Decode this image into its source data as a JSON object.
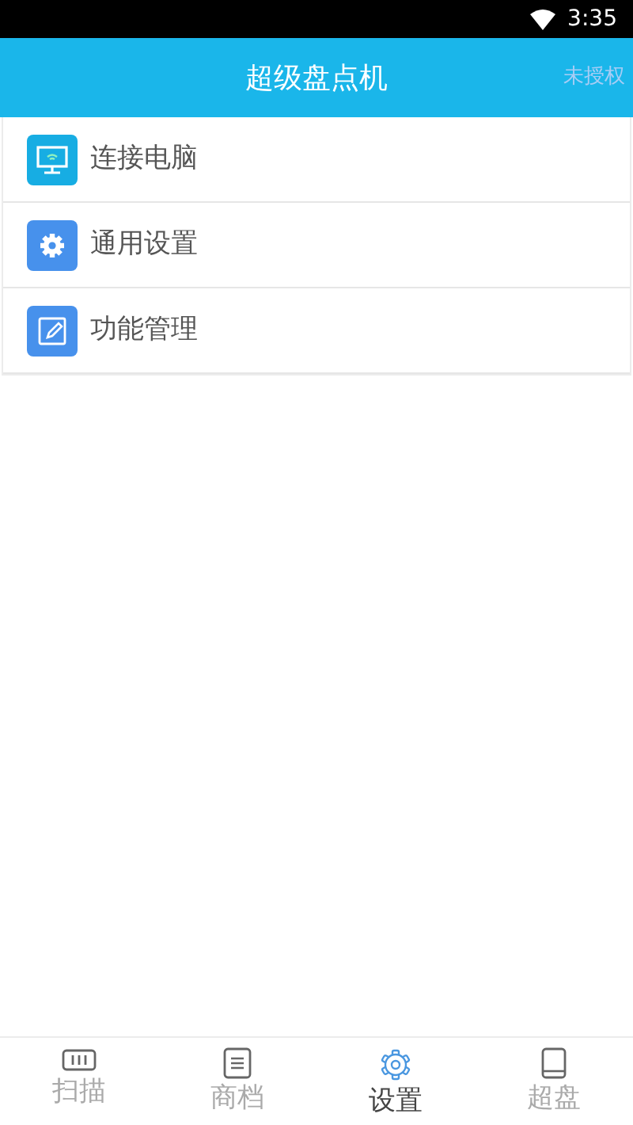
{
  "status_bar": {
    "time": "3:35"
  },
  "header": {
    "title": "超级盘点机",
    "action": "未授权"
  },
  "menu": [
    {
      "label": "连接电脑",
      "kind": "monitor",
      "color": "#17ade3"
    },
    {
      "label": "通用设置",
      "kind": "gear",
      "color": "#4791ec"
    },
    {
      "label": "功能管理",
      "kind": "edit",
      "color": "#4791ec"
    }
  ],
  "tabs": [
    {
      "label": "扫描",
      "kind": "barcode",
      "selected": false
    },
    {
      "label": "商档",
      "kind": "document",
      "selected": false
    },
    {
      "label": "设置",
      "kind": "gear",
      "selected": true
    },
    {
      "label": "超盘",
      "kind": "book",
      "selected": false
    }
  ]
}
